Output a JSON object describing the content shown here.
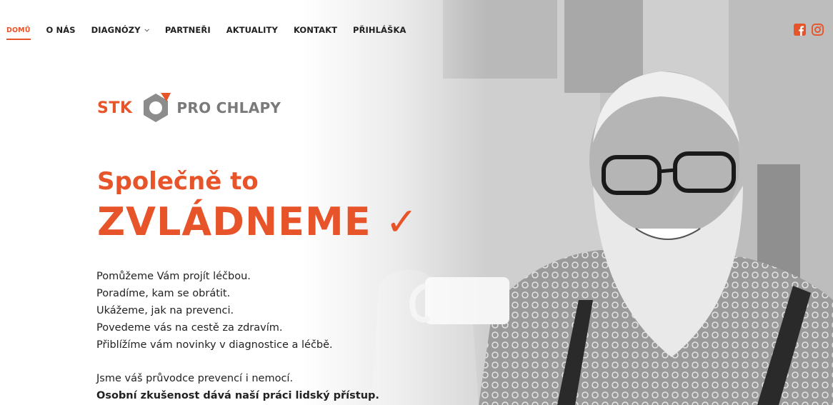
{
  "nav": {
    "items": [
      {
        "label": "DOMŮ",
        "active": true
      },
      {
        "label": "O NÁS",
        "active": false
      },
      {
        "label": "DIAGNÓZY",
        "active": false,
        "has_dropdown": true
      },
      {
        "label": "PARTNEŘI",
        "active": false
      },
      {
        "label": "AKTUALITY",
        "active": false
      },
      {
        "label": "KONTAKT",
        "active": false
      },
      {
        "label": "PŘIHLÁŠKA",
        "active": false
      }
    ],
    "dropdown_icon": "chevron-down-icon"
  },
  "social": {
    "facebook_icon": "facebook-icon",
    "instagram_icon": "instagram-icon"
  },
  "logo": {
    "left": "STK",
    "right": "PRO CHLAPY",
    "mark_icon": "hex-nut-icon"
  },
  "hero": {
    "headline_small": "Společně to",
    "headline_big": "ZVLÁDNEME ✓",
    "lines": [
      "Pomůžeme Vám projít léčbou.",
      "Poradíme, kam se obrátit.",
      "Ukážeme, jak na prevenci.",
      "Povedeme vás na cestě za zdravím.",
      "Přiblížíme vám novinky v diagnostice a léčbě."
    ],
    "closing_line": "Jsme váš průvodce prevencí i nemocí.",
    "closing_bold": "Osobní zkušenost dává naší práci lidský přístup."
  },
  "colors": {
    "accent": "#e8542a",
    "text": "#222222",
    "logo_gray": "#7a7a7a"
  }
}
